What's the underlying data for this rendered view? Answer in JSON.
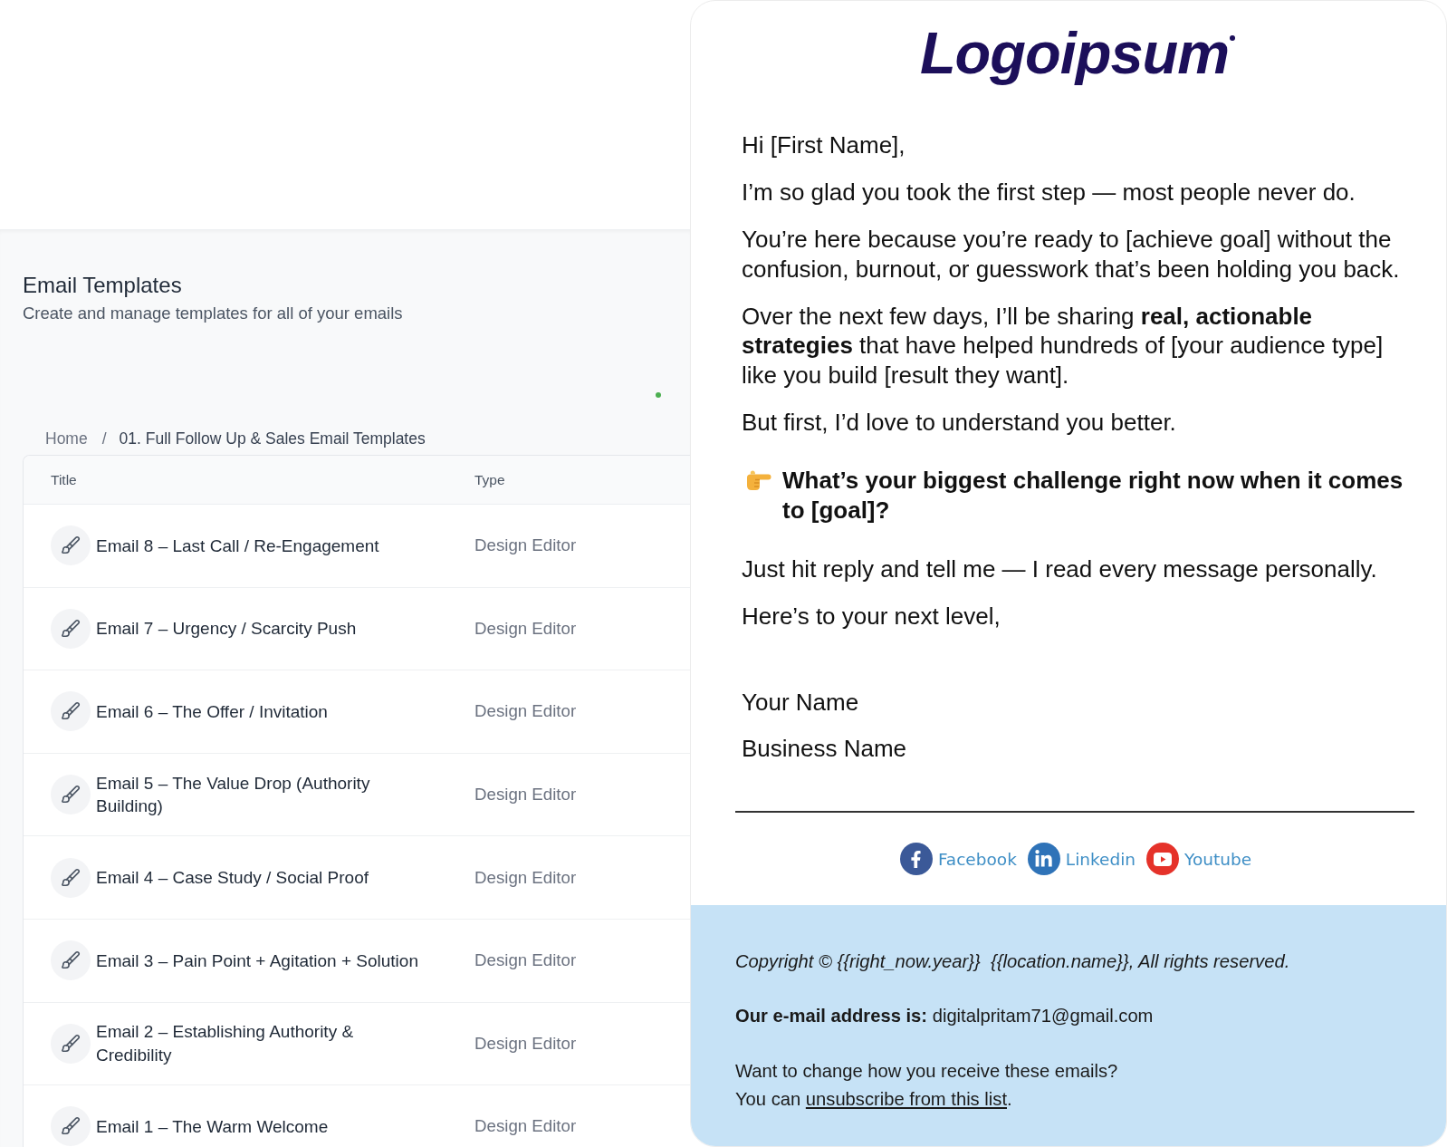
{
  "templates_page": {
    "title": "Email Templates",
    "subtitle": "Create and manage templates for all of your emails",
    "breadcrumb": {
      "separator": "/",
      "items": [
        {
          "label": "Home",
          "current": false
        },
        {
          "label": "01. Full Follow Up & Sales Email Templates",
          "current": true
        }
      ]
    },
    "table": {
      "columns": [
        "Title",
        "Type"
      ],
      "rows": [
        {
          "title": "Email 8 – Last Call / Re-Engagement",
          "type": "Design Editor"
        },
        {
          "title": "Email 7 – Urgency / Scarcity Push",
          "type": "Design Editor"
        },
        {
          "title": "Email 6 – The Offer / Invitation",
          "type": "Design Editor"
        },
        {
          "title": "Email 5 – The Value Drop (Authority Building)",
          "type": "Design Editor"
        },
        {
          "title": "Email 4 – Case Study / Social Proof",
          "type": "Design Editor"
        },
        {
          "title": "Email 3 – Pain Point + Agitation + Solution",
          "type": "Design Editor"
        },
        {
          "title": "Email 2 – Establishing Authority & Credibility",
          "type": "Design Editor"
        },
        {
          "title": "Email 1 – The Warm Welcome",
          "type": "Design Editor"
        }
      ]
    }
  },
  "email_preview": {
    "logo": "Logoipsum",
    "greeting": "Hi [First Name],",
    "paragraphs": [
      "I’m so glad you took the first step — most people never do.",
      "You’re here because you’re ready to [achieve goal] without the confusion, burnout, or guesswork that’s been holding you back.",
      "Over the next few days, I’ll be sharing **real, actionable strategies** that have helped hundreds of [your audience type] like you build [result they want].",
      "But first, I’d love to understand you better."
    ],
    "question": "What’s your biggest challenge right now when it comes to [goal]?",
    "closing_paragraphs": [
      "Just hit reply and tell me — I read every message personally."
    ],
    "sign_off": "Here’s to your next level,",
    "signature": [
      "Your Name",
      "Business Name"
    ],
    "social_links": [
      {
        "kind": "facebook",
        "label": "Facebook"
      },
      {
        "kind": "linkedin",
        "label": "Linkedin"
      },
      {
        "kind": "youtube",
        "label": "Youtube"
      }
    ]
  },
  "email_footer": {
    "copyright": "Copyright © {{right_now.year}}  {{location.name}}, All rights reserved.",
    "email_line": "**Our e-mail address is:** digitalpritam71@gmail.com",
    "change_prompt": "Want to change how you receive these emails?",
    "unsubscribe": {
      "before": "You can",
      "link": "unsubscribe from this list",
      "after": "."
    }
  }
}
